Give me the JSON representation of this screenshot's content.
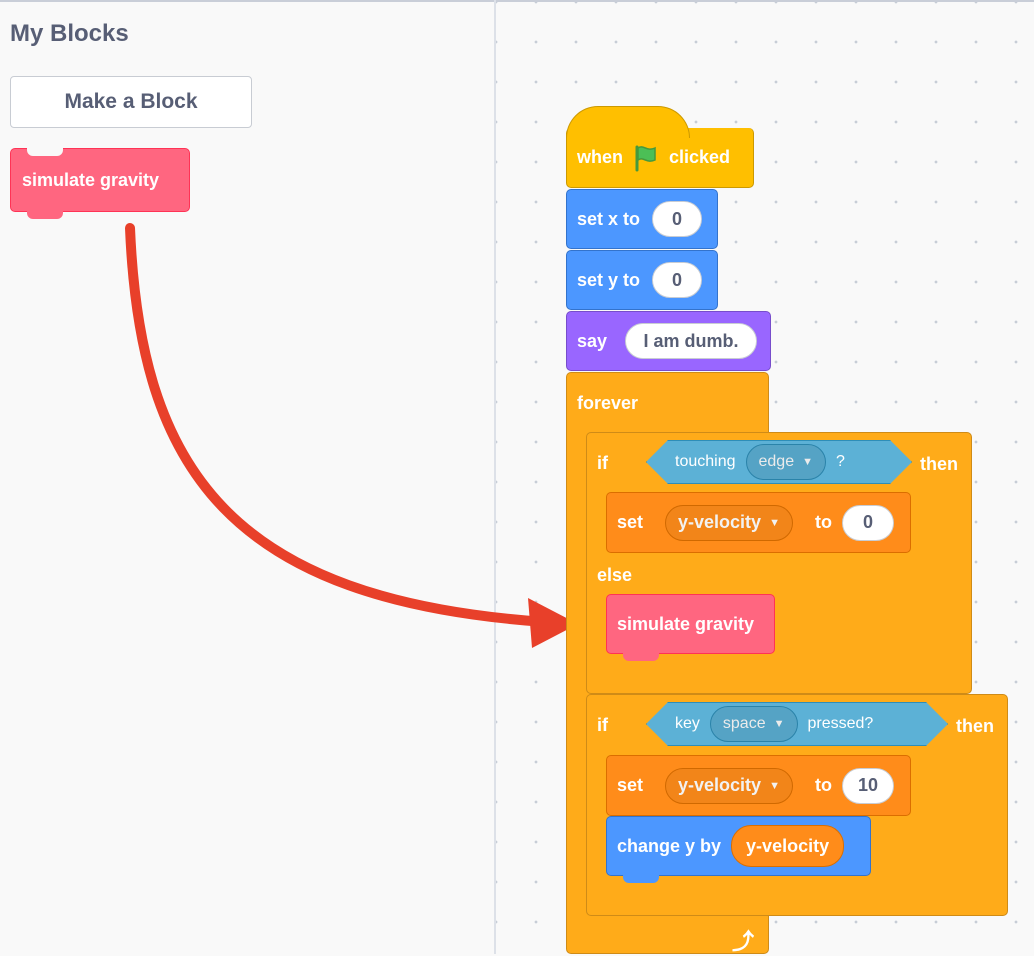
{
  "palette": {
    "category_title": "My Blocks",
    "make_block_label": "Make a Block",
    "custom_block_label": "simulate gravity"
  },
  "script": {
    "hat": {
      "when": "when",
      "clicked": "clicked",
      "flag_icon": "green-flag-icon"
    },
    "set_x": {
      "label": "set x to",
      "value": "0"
    },
    "set_y": {
      "label": "set y to",
      "value": "0"
    },
    "say": {
      "label": "say",
      "value": "I am dumb."
    },
    "forever": {
      "label": "forever",
      "loop_icon": "loop-arrow-icon"
    },
    "if1": {
      "if": "if",
      "then": "then",
      "else": "else",
      "condition": {
        "label": "touching",
        "option": "edge",
        "suffix": "?"
      },
      "set_var": {
        "set": "set",
        "variable": "y-velocity",
        "to": "to",
        "value": "0"
      },
      "else_block": "simulate gravity"
    },
    "if2": {
      "if": "if",
      "then": "then",
      "condition": {
        "label": "key",
        "option": "space",
        "suffix": "pressed?"
      },
      "set_var": {
        "set": "set",
        "variable": "y-velocity",
        "to": "to",
        "value": "10"
      },
      "change": {
        "label": "change y by",
        "reporter": "y-velocity"
      }
    }
  },
  "colors": {
    "control": "#ffab19",
    "motion": "#4c97ff",
    "looks": "#9966ff",
    "variables": "#ff8c1a",
    "my_blocks": "#ff6680",
    "sensing": "#5cb1d6",
    "arrow": "#e8402a"
  }
}
